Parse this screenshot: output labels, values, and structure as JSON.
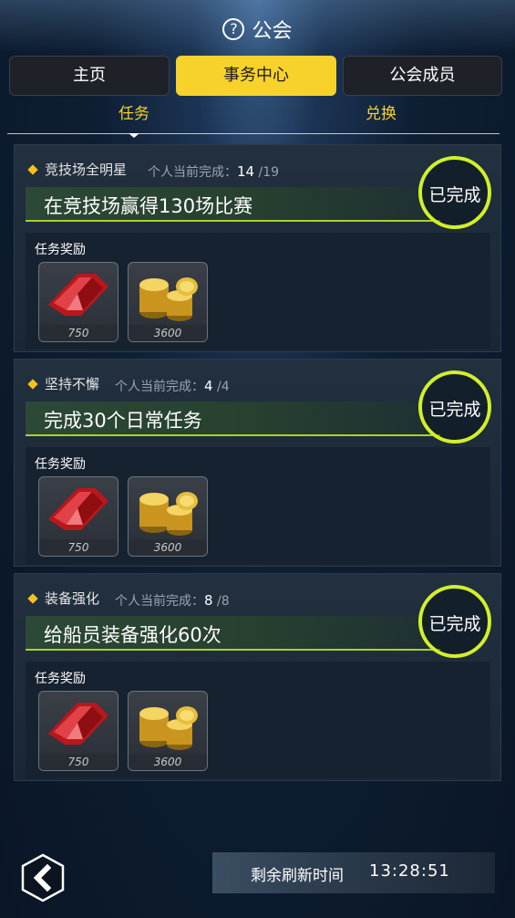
{
  "header": {
    "title": "公会",
    "help_icon": "help-icon"
  },
  "tabs": [
    {
      "label": "主页",
      "active": false
    },
    {
      "label": "事务中心",
      "active": true
    },
    {
      "label": "公会成员",
      "active": false
    }
  ],
  "subtabs": [
    {
      "label": "任务",
      "active": true
    },
    {
      "label": "兑换",
      "active": false
    }
  ],
  "tasks": [
    {
      "name": "竞技场全明星",
      "progress_label": "个人当前完成：",
      "current": "14",
      "total": "/19",
      "description": "在竞技场赢得130场比赛",
      "status": "已完成",
      "reward_label": "任务奖励",
      "rewards": [
        {
          "icon": "red-gem-icon",
          "qty": "750"
        },
        {
          "icon": "gold-coins-icon",
          "qty": "3600"
        }
      ]
    },
    {
      "name": "坚持不懈",
      "progress_label": "个人当前完成：",
      "current": "4",
      "total": "/4",
      "description": "完成30个日常任务",
      "status": "已完成",
      "reward_label": "任务奖励",
      "rewards": [
        {
          "icon": "red-gem-icon",
          "qty": "750"
        },
        {
          "icon": "gold-coins-icon",
          "qty": "3600"
        }
      ]
    },
    {
      "name": "装备强化",
      "progress_label": "个人当前完成：",
      "current": "8",
      "total": "/8",
      "description": "给船员装备强化60次",
      "status": "已完成",
      "reward_label": "任务奖励",
      "rewards": [
        {
          "icon": "red-gem-icon",
          "qty": "750"
        },
        {
          "icon": "gold-coins-icon",
          "qty": "3600"
        }
      ]
    }
  ],
  "footer": {
    "refresh_label": "剩余刷新时间",
    "refresh_time": "13:28:51",
    "back_icon": "back-chevron-icon"
  },
  "colors": {
    "accent_yellow": "#f7d22b",
    "done_green": "#d2f02a"
  }
}
